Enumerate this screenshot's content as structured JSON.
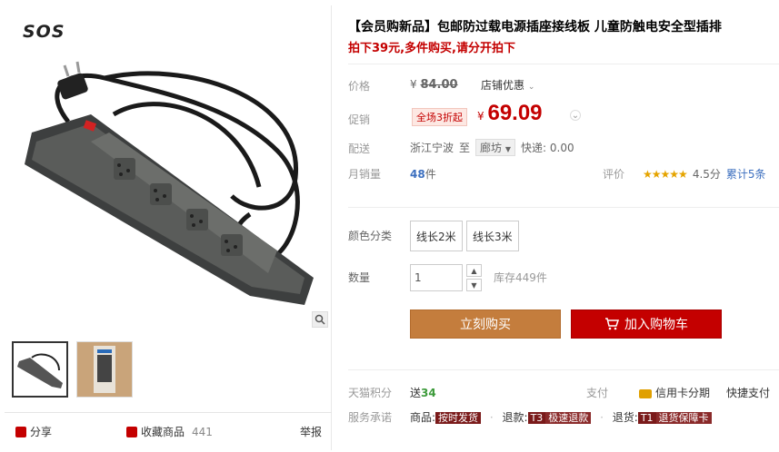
{
  "gallery": {
    "brand_logo": "SOS",
    "share_label": "分享",
    "favorite_label": "收藏商品",
    "favorite_count": "441",
    "report_label": "举报"
  },
  "product": {
    "title": "【会员购新品】包邮防过载电源插座接线板 儿童防触电安全型插排",
    "subtitle": "拍下39元,多件购买,请分开拍下"
  },
  "price": {
    "label": "价格",
    "currency": "¥",
    "original": "84.00",
    "shop_deal": "店铺优惠",
    "promo_label": "促销",
    "promo_tag": "全场3折起",
    "promo_price": "69.09"
  },
  "shipping": {
    "label": "配送",
    "from": "浙江宁波",
    "to_word": "至",
    "city": "廊坊",
    "fee": "快递: 0.00"
  },
  "sales": {
    "label": "月销量",
    "count": "48",
    "unit": "件"
  },
  "rating": {
    "label": "评价",
    "stars": "★★★★★",
    "score": "4.5分",
    "total": "累计5条"
  },
  "sku": {
    "color_label": "颜色分类",
    "options": [
      "线长2米",
      "线长3米"
    ],
    "qty_label": "数量",
    "qty_value": "1",
    "stock": "库存449件",
    "buy_label": "立刻购买",
    "cart_label": "加入购物车"
  },
  "extras": {
    "points_label": "天猫积分",
    "points_prefix": "送",
    "points_value": "34",
    "pay_label": "支付",
    "installment": "信用卡分期",
    "quick_pay": "快捷支付",
    "service_label": "服务承诺",
    "goods_prefix": "商品:",
    "goods_tag": "按时发货",
    "refund_prefix": "退款:",
    "refund_code": "T3",
    "refund_tag": "极速退款",
    "return_prefix": "退货:",
    "return_code": "T1",
    "return_tag": "退货保障卡"
  }
}
